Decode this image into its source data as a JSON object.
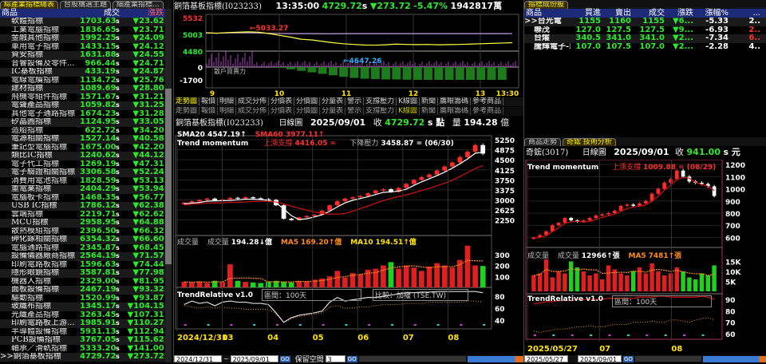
{
  "left": {
    "tabs": [
      "綜產業指標總表",
      "台股構選主題",
      "細產業指標..."
    ],
    "headers": [
      "商品",
      "成交",
      "漲跌"
    ],
    "rows": [
      [
        "軟體指標",
        "1703.63",
        "23.62"
      ],
      [
        "工業電腦指標",
        "1836.65",
        "23.71"
      ],
      [
        "金融其他指標",
        "1992.25",
        "24.09"
      ],
      [
        "車用電子指標",
        "1433.15",
        "24.12"
      ],
      [
        "資安指標",
        "1631.88",
        "24.55"
      ],
      [
        "音響設備及零件...",
        "966.44",
        "24.71"
      ],
      [
        "IC基板指標",
        "433.19",
        "24.87"
      ],
      [
        "電線電纜指標",
        "1134.72",
        "25.76"
      ],
      [
        "建材指標",
        "1089.69",
        "28.80"
      ],
      [
        "飛機零組件指標",
        "1571.67",
        "31.21"
      ],
      [
        "電聲產品指標",
        "1059.82",
        "31.25"
      ],
      [
        "其他電子通路指標",
        "1674.23",
        "31.28"
      ],
      [
        "矽晶圓指標",
        "1124.95",
        "33.05"
      ],
      [
        "造船指標",
        "622.72",
        "34.20"
      ],
      [
        "電源相關指標",
        "1527.14",
        "40.58"
      ],
      [
        "筆記型電腦指標",
        "1675.00",
        "42.20"
      ],
      [
        "類比IC指標",
        "1240.62",
        "44.12"
      ],
      [
        "電子代工指標",
        "1269.19",
        "47.31"
      ],
      [
        "電子驗證相關指標",
        "3306.58",
        "52.24"
      ],
      [
        "消費用電池指標",
        "1828.59",
        "53.13"
      ],
      [
        "重電業指標",
        "2404.29",
        "53.94"
      ],
      [
        "電腦板卡指標",
        "1468.35",
        "56.77"
      ],
      [
        "USB IC指標",
        "1786.12",
        "62.38"
      ],
      [
        "雲端指標",
        "2219.71",
        "62.62"
      ],
      [
        "MCU指標",
        "2958.95",
        "64.88"
      ],
      [
        "散熱模組指標",
        "2396.50",
        "66.32"
      ],
      [
        "砷化鎵相關指標",
        "6354.32",
        "66.60"
      ],
      [
        "電腦通路指標",
        "2345.87",
        "68.45"
      ],
      [
        "設備儀器廠商指標",
        "2564.19",
        "71.57"
      ],
      [
        "印刷電路板指標",
        "1596.63",
        "74.44"
      ],
      [
        "隱形眼鏡指標",
        "3587.81",
        "77.98"
      ],
      [
        "機器人指標",
        "2329.00",
        "81.95"
      ],
      [
        "面板設備指標",
        "2467.19",
        "93.32"
      ],
      [
        "驅動指標",
        "1520.99",
        "93.87"
      ],
      [
        "玻纖布指標",
        "1345.17",
        "104.15"
      ],
      [
        "光纖產品指標",
        "3263.45",
        "107.31"
      ],
      [
        "印刷電路板上游...",
        "1985.91",
        "110.27"
      ],
      [
        "半導體設備指標",
        "5931.13",
        "112.94"
      ],
      [
        "PCB設備指標",
        "3767.05",
        "115.62"
      ],
      [
        "軸承／滑軌指標",
        "5333.20",
        "141.00"
      ],
      [
        ">>銅箔基板指標",
        "4729.72",
        "273.72"
      ]
    ],
    "suffix": "s",
    "down": "▼"
  },
  "intraday": {
    "title": "銅箔基板指標(I023233)",
    "time": "13:35:00",
    "price": "4729.72",
    "suffix": "s",
    "change": "▼273.72",
    "pct": "-5.47%",
    "amount": "1942817萬",
    "yticks": [
      "5532",
      "5003",
      "4480",
      "0",
      "-1700"
    ],
    "high_label": "←5033.27",
    "low_label": "←4647.26",
    "sub_label": "散戶買賣力",
    "xticks": [
      "9",
      "10",
      "11",
      "12",
      "13",
      "13:30"
    ],
    "price_series": [
      5003,
      4990,
      5010,
      5020,
      5033,
      5020,
      4980,
      4930,
      4880,
      4820,
      4800,
      4760,
      4720,
      4690,
      4670,
      4655,
      4650,
      4660,
      4680,
      4670,
      4665,
      4670,
      4660,
      4665,
      4670,
      4680,
      4690,
      4700,
      4710,
      4720
    ],
    "ref_series": [
      5003,
      4995,
      5000,
      5005,
      5003,
      5000,
      4990,
      4985,
      4980,
      4980,
      4980,
      4978,
      4978,
      4980,
      4980,
      4980,
      4980,
      4980,
      4980,
      4980,
      4980,
      4980,
      4980,
      4980,
      4980,
      4980,
      4980,
      4980,
      4980,
      4982
    ],
    "force_series": [
      900,
      700,
      600,
      500,
      450,
      400,
      350,
      -100,
      -300,
      -500,
      -700,
      -900,
      -1100,
      -1300,
      -1450,
      -1550,
      -1600,
      -1650,
      -1650,
      -1680,
      -1700,
      -1700,
      -1700,
      -1700,
      -1700,
      -1700,
      -1700,
      -1700,
      -1700,
      800
    ]
  },
  "func_tabs": [
    "走勢圖",
    "報價",
    "明細",
    "成交分佈",
    "分價表",
    "分價圖",
    "分量表",
    "警示",
    "支撐壓力",
    "K線圖",
    "新聞",
    "鷹眼籌碼",
    "參考商品"
  ],
  "daily": {
    "title": "銅箔基板指標(I023233)",
    "period": "日線圖",
    "date": "2025/09/01",
    "close_label": "收",
    "close": "4729.72",
    "unit": "s 點",
    "vol_label": "量",
    "vol": "194.28",
    "vol_unit": "億",
    "sma20_label": "SMA20",
    "sma20": "4547.19↑",
    "sma60_label": "SMA60",
    "sma60": "3977.11↑",
    "tm_label": "Trend momentum",
    "support_label": "上漲支撐",
    "support": "4416.05 =",
    "resist_label": "下降壓力",
    "resist": "3458.87 = (06/30)",
    "yticks": [
      "5250",
      "4875",
      "4500",
      "4125",
      "3750",
      "3375",
      "3000",
      "2625",
      "2250"
    ],
    "closes": [
      2900,
      2950,
      3000,
      3050,
      2980,
      3020,
      3080,
      3050,
      3100,
      3060,
      3030,
      3000,
      2800,
      2300,
      2250,
      2350,
      2400,
      2450,
      2600,
      2800,
      2950,
      3050,
      3100,
      3150,
      3250,
      3350,
      3400,
      3300,
      3450,
      3600,
      3750,
      3850,
      3950,
      4100,
      4250,
      4400,
      4600,
      4800,
      5050,
      4730
    ],
    "volume_label": "成交量",
    "volume_title": "成交量",
    "volume": "194.28↓億",
    "ma5_label": "MA5",
    "ma5": "169.20↑億",
    "ma10_label": "MA10",
    "ma10": "194.51↑億",
    "vol_yticks": [
      "300",
      "200",
      "100"
    ],
    "volumes": [
      50,
      45,
      55,
      40,
      60,
      50,
      210,
      60,
      50,
      45,
      40,
      55,
      60,
      50,
      45,
      60,
      55,
      70,
      80,
      100,
      150,
      90,
      130,
      120,
      160,
      170,
      200,
      230,
      170,
      200,
      180,
      150,
      190,
      220,
      200,
      180,
      250,
      380,
      200,
      195
    ],
    "tr_label": "TrendRelative v1.0",
    "tr_period": "區間：100天",
    "tr_compare": "比較：加權 (TSE.TW)",
    "tr_yticks": [
      "80",
      "60",
      "40"
    ],
    "tr_series": [
      66,
      72,
      68,
      70,
      64,
      70,
      72,
      70,
      70,
      68,
      68,
      66,
      52,
      36,
      44,
      48,
      50,
      52,
      55,
      70,
      78,
      72,
      74,
      76,
      78,
      78,
      80,
      82,
      84,
      86,
      86,
      87,
      87,
      88,
      88,
      88,
      88,
      88,
      88,
      86
    ],
    "tr_ref": [
      64,
      62,
      60,
      62,
      60,
      62,
      60,
      60,
      58,
      58,
      58,
      58,
      50,
      36,
      42,
      46,
      48,
      50,
      52,
      62,
      64,
      60,
      60,
      62,
      62,
      64,
      66,
      66,
      66,
      68,
      68,
      68,
      70,
      70,
      70,
      70,
      70,
      72,
      72,
      70
    ],
    "xticks": [
      "2024/12/31",
      "03",
      "04",
      "05",
      "06",
      "07",
      "08"
    ],
    "from": "2024/12/31",
    "to": "2025/09/01",
    "keep_label": "保留空間",
    "keep_value": "3",
    "go": "GO"
  },
  "components": {
    "tab": "指標成份股",
    "headers": [
      "商品",
      "買進",
      "賣出",
      "成交",
      "漲跌",
      "漲幅%",
      "..."
    ],
    "rows": [
      [
        ">>台光電",
        "1155",
        "1160",
        "1155",
        "▼6...",
        "-5.33",
        "2.."
      ],
      [
        "聯茂",
        "127.0",
        "127.5",
        "127.5",
        "▼9...",
        "-6.93",
        "2.."
      ],
      [
        "台燿",
        "340.5",
        "341.0",
        "341.0",
        "▼2...",
        "-7.34",
        "6.."
      ],
      [
        "騰輝電子-KY",
        "107.0",
        "107.5",
        "107.0",
        "▼2...",
        "-2.28",
        "4.."
      ]
    ]
  },
  "stock": {
    "tabs": [
      "商品走勢",
      "奇鋐 技術分析"
    ],
    "title": "奇鋐(3017)",
    "period": "日線圖",
    "date": "2025/09/01",
    "close_label": "收",
    "close": "941.00",
    "unit": "s 元",
    "tm_label": "Trend momentum",
    "support_label": "上漲支撐",
    "support": "1009.88 = (08/29)",
    "yticks": [
      "1200",
      "1100",
      "1000",
      "900",
      "800",
      "700",
      "600"
    ],
    "closes": [
      600,
      620,
      650,
      700,
      720,
      760,
      740,
      730,
      740,
      760,
      780,
      790,
      800,
      820,
      860,
      870,
      860,
      880,
      900,
      960,
      1000,
      1050,
      1080,
      1150,
      1100,
      1060,
      1050,
      1040,
      1020,
      941
    ],
    "volume_title": "成交量",
    "volume_label": "成交量",
    "volume": "12966↑張",
    "ma5_label": "MA5",
    "ma5": "7481↑張",
    "vol_yticks": [
      "15K",
      "10K",
      "5K"
    ],
    "volumes": [
      8,
      9,
      16,
      7,
      10,
      9,
      15,
      12,
      10,
      8,
      9,
      6,
      13,
      11,
      9,
      8,
      10,
      12,
      9,
      14,
      10,
      8,
      9,
      12,
      10,
      7,
      6,
      9,
      8,
      13
    ],
    "tr_label": "TrendRelative v1.0",
    "tr_period": "區間：100天",
    "tr_yticks": [
      "90",
      "80",
      "70",
      "60"
    ],
    "tr_series": [
      86,
      87,
      88,
      88,
      89,
      89,
      89,
      90,
      90,
      90,
      90,
      90,
      91,
      91,
      91,
      91,
      91,
      92,
      92,
      92,
      93,
      93,
      92,
      92,
      92,
      92,
      92,
      93,
      92,
      90
    ],
    "tr_ref": [
      62,
      61,
      62,
      63,
      64,
      64,
      65,
      66,
      66,
      67,
      66,
      66,
      67,
      68,
      68,
      68,
      70,
      70,
      70,
      71,
      70,
      70,
      72,
      72,
      71,
      70,
      72,
      73,
      74,
      72
    ],
    "xticks": [
      "2025/05/27",
      "07",
      "08"
    ],
    "from": "2025/05/27",
    "to": "2025/09/01",
    "go": "GO"
  },
  "colors": {
    "up": "#ff2a2a",
    "down": "#2ee82e",
    "header": "#1d2a78",
    "accent": "#ffe400"
  }
}
